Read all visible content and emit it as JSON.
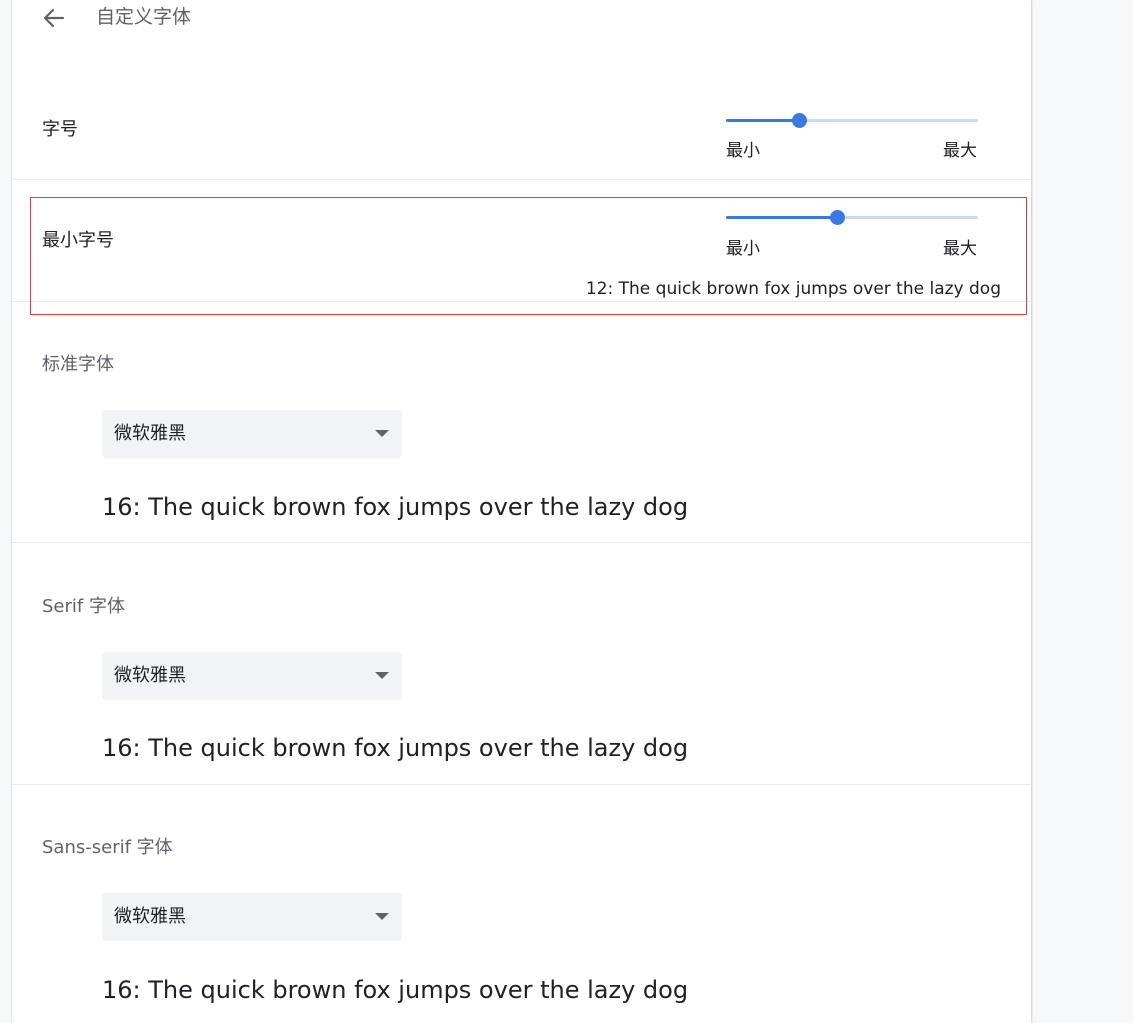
{
  "header": {
    "title": "自定义字体",
    "back_icon": "arrow-left-icon"
  },
  "font_size": {
    "label": "字号",
    "slider_value_fraction": 0.29,
    "min_label": "最小",
    "max_label": "最大"
  },
  "min_font_size": {
    "label": "最小字号",
    "slider_value_fraction": 0.44,
    "min_label": "最小",
    "max_label": "最大",
    "sample": "12: The quick brown fox jumps over the lazy dog"
  },
  "standard_font": {
    "label": "标准字体",
    "selected": "微软雅黑",
    "sample": "16: The quick brown fox jumps over the lazy dog"
  },
  "serif_font": {
    "label": "Serif 字体",
    "selected": "微软雅黑",
    "sample": "16: The quick brown fox jumps over the lazy dog"
  },
  "sans_serif_font": {
    "label": "Sans-serif 字体",
    "selected": "微软雅黑",
    "sample": "16: The quick brown fox jumps over the lazy dog"
  },
  "colors": {
    "accent": "#3a78e2",
    "track": "#c9daf2",
    "highlight": "#e0393e"
  }
}
